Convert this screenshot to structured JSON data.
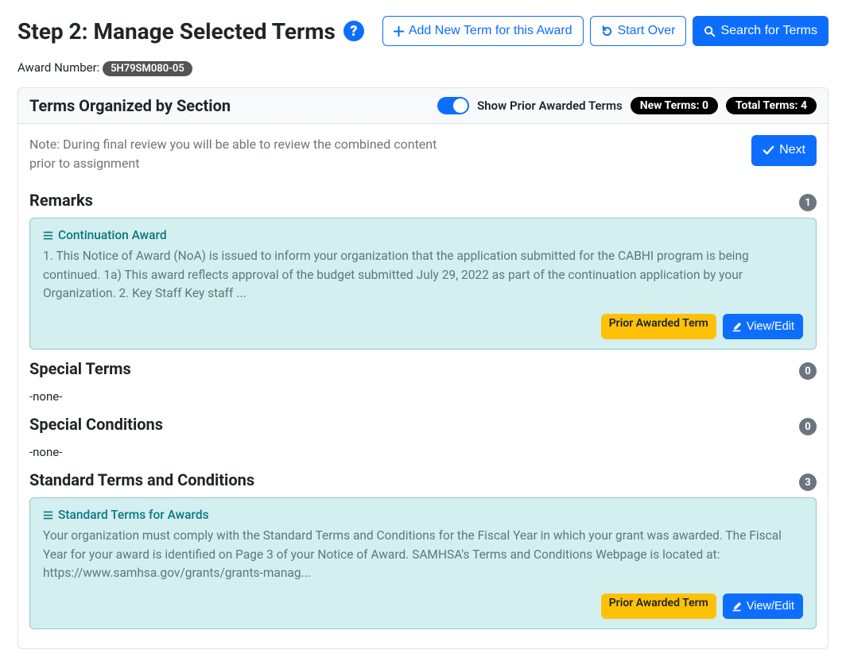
{
  "header": {
    "title": "Step 2: Manage Selected Terms",
    "buttons": {
      "add_term": "Add New Term for this Award",
      "start_over": "Start Over",
      "search": "Search for Terms"
    }
  },
  "award": {
    "label": "Award Number:",
    "number": "5H79SM080-05"
  },
  "panel": {
    "title": "Terms Organized by Section",
    "toggle_label": "Show Prior Awarded Terms",
    "new_terms_label": "New Terms: 0",
    "total_terms_label": "Total Terms: 4"
  },
  "note": "Note: During final review you will be able to review the combined content prior to assignment",
  "next_label": "Next",
  "sections": {
    "remarks": {
      "title": "Remarks",
      "count": "1"
    },
    "special_terms": {
      "title": "Special Terms",
      "count": "0",
      "none": "-none-"
    },
    "special_conditions": {
      "title": "Special Conditions",
      "count": "0",
      "none": "-none-"
    },
    "standard": {
      "title": "Standard Terms and Conditions",
      "count": "3"
    }
  },
  "cards": {
    "remarks": {
      "title": "Continuation Award",
      "body": "1. This Notice of Award (NoA) is issued to inform your organization that the application submitted for the CABHI program is being continued. 1a) This award reflects approval of the budget submitted July 29, 2022 as part of the continuation application by your Organization. 2. Key Staff Key staff ...",
      "prior_label": "Prior Awarded Term",
      "view_label": "View/Edit"
    },
    "standard": {
      "title": "Standard Terms for Awards",
      "body": "Your organization must comply with the Standard Terms and Conditions for the Fiscal Year in which your grant was awarded. The Fiscal Year for your award is identified on Page 3 of your Notice of Award. SAMHSA's Terms and Conditions Webpage is located at: https://www.samhsa.gov/grants/grants-manag...",
      "prior_label": "Prior Awarded Term",
      "view_label": "View/Edit"
    }
  }
}
